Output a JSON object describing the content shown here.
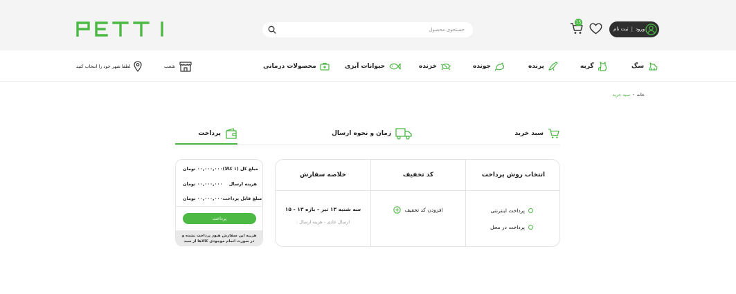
{
  "header": {
    "logo_text": "PETTI",
    "search": {
      "placeholder": "جستجوی محصول",
      "value": ""
    },
    "cart_count": "15",
    "login": {
      "login_label": "ورود",
      "separator": "|",
      "signup_label": "ثبت نام"
    }
  },
  "nav": {
    "items": [
      {
        "label": "سگ",
        "icon": "dog-icon"
      },
      {
        "label": "گربه",
        "icon": "cat-icon"
      },
      {
        "label": "پرنده",
        "icon": "bird-icon"
      },
      {
        "label": "جونده",
        "icon": "rodent-icon"
      },
      {
        "label": "خزنده",
        "icon": "reptile-icon"
      },
      {
        "label": "حیوانات آبزی",
        "icon": "fish-icon"
      },
      {
        "label": "محصولات درمانی",
        "icon": "medical-kit-icon"
      }
    ],
    "branches_label": "شعب",
    "city_label": "لطفا شهر خود را انتخاب کنید"
  },
  "breadcrumb": {
    "home": "خانه",
    "current": "سبد خرید"
  },
  "steps": [
    {
      "label": "سبد خرید"
    },
    {
      "label": "زمان و نحوه ارسال"
    },
    {
      "label": "پرداخت"
    }
  ],
  "checkout": {
    "payment_header": "انتخاب روش پرداخت",
    "payment_options": [
      "پرداخت اینترنتی",
      "پرداخت در محل"
    ],
    "discount_header": "کد تخفیف",
    "add_discount_label": "افزودن کد تخفیف",
    "summary_header": "خلاصه سفارش",
    "summary_time": "سه شنبه ۱۳ تیر - بازه ۱۳ - ۱۵",
    "summary_shipping": "ارسال عادی - هزینه ارسال :"
  },
  "price_box": {
    "rows": [
      {
        "label": "مبلغ کل (۱ کالا)",
        "value": "۰۰,۰۰۰,۰۰۰ تومان"
      },
      {
        "label": "هزینه ارسال",
        "value": "۰۰,۰۰۰,۰۰۰ تومان"
      },
      {
        "label": "مبلغ قابل پرداخت",
        "value": "۰۰,۰۰۰,۰۰۰ تومان"
      }
    ],
    "pay_button": "پرداخت",
    "note": "هزینه این سفارش هنوز پرداخت نشده و در صورت اتمام موجودی کالاها از سبد حذف می‌شوند"
  },
  "colors": {
    "accent": "#4cb944",
    "header_bg": "#f4f4f4",
    "dark": "#2e2e2e"
  }
}
